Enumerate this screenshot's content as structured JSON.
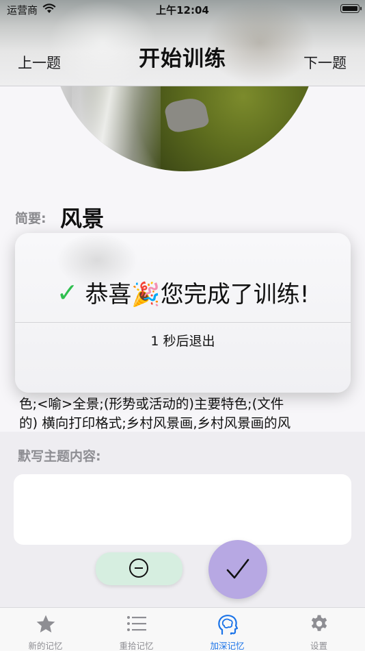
{
  "status_bar": {
    "carrier": "运营商",
    "time": "上午12:04"
  },
  "nav": {
    "prev_label": "上一题",
    "title": "开始训练",
    "next_label": "下一题"
  },
  "summary": {
    "label": "简要:",
    "value": "风景"
  },
  "description": {
    "line1": "色;<喻>全景;(形势或活动的)主要特色;(文件",
    "line2": "的) 横向打印格式;乡村风景画,乡村风景画的风"
  },
  "dictation": {
    "label": "默写主题内容:",
    "value": ""
  },
  "overlay": {
    "message": "恭喜🎉您完成了训练!",
    "countdown": "1 秒后退出",
    "success_color": "#2fbf4f"
  },
  "tabs": [
    {
      "label": "新的记忆",
      "icon": "star-icon",
      "active": false
    },
    {
      "label": "重拾记忆",
      "icon": "list-icon",
      "active": false
    },
    {
      "label": "加深记忆",
      "icon": "brain-icon",
      "active": true
    },
    {
      "label": "设置",
      "icon": "gear-icon",
      "active": false
    }
  ],
  "colors": {
    "accent": "#1a73e8",
    "minus_button": "#d6eee0",
    "check_button": "#b7a8e3"
  }
}
